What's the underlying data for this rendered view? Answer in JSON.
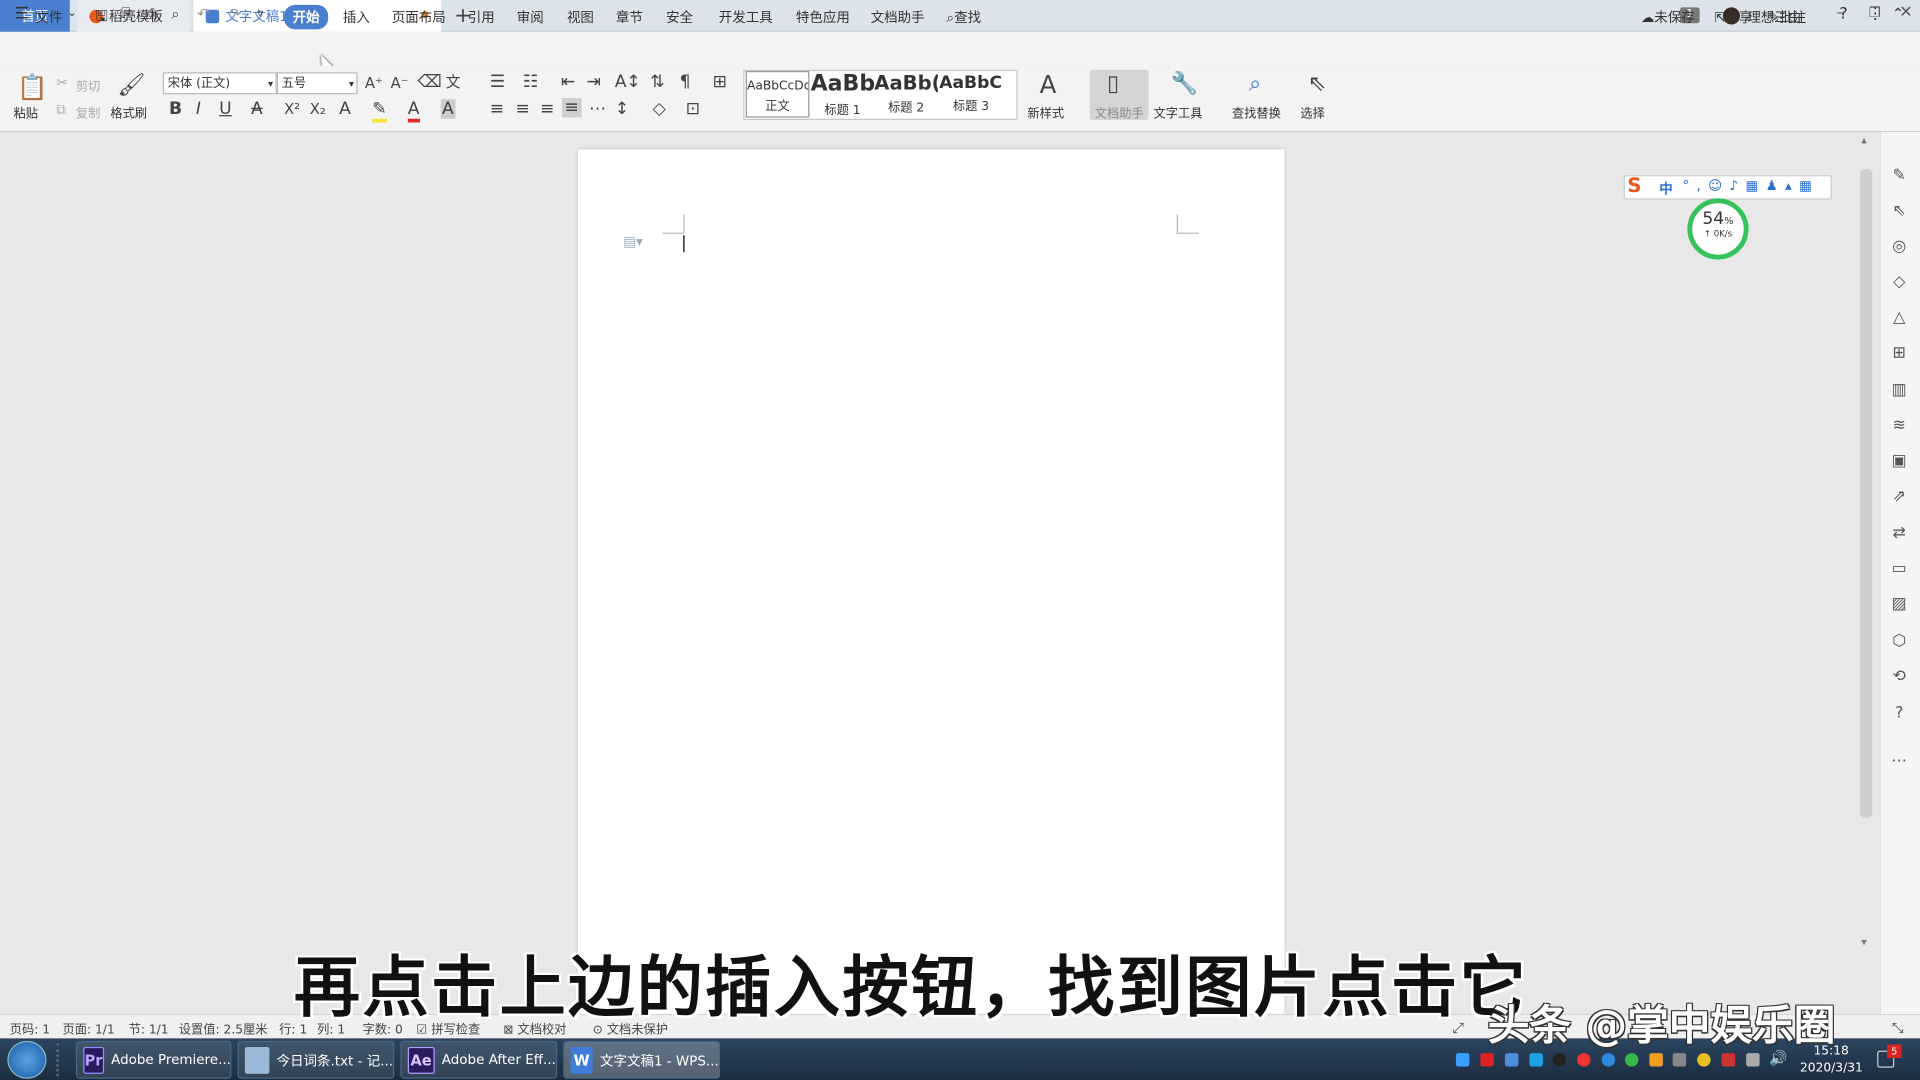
{
  "tabs": {
    "home": "首页",
    "daoke": "稻壳模板",
    "doc": "文字文稿1",
    "win_badge": "1",
    "user": "理想三由"
  },
  "menubar": {
    "file": "文件",
    "items": [
      "开始",
      "插入",
      "页面布局",
      "引用",
      "审阅",
      "视图",
      "章节",
      "安全",
      "开发工具",
      "特色应用",
      "文档助手"
    ],
    "search": "查找",
    "unsaved": "未保存",
    "share": "分享",
    "comment": "批注"
  },
  "ribbon": {
    "paste": "粘贴",
    "cut": "剪切",
    "copy": "复制",
    "format_painter": "格式刷",
    "font_name": "宋体 (正文)",
    "font_size": "五号",
    "styles": [
      {
        "sample": "AaBbCcDd",
        "label": "正文"
      },
      {
        "sample": "AaBb",
        "label": "标题 1"
      },
      {
        "sample": "AaBb(",
        "label": "标题 2"
      },
      {
        "sample": "AaBbC(",
        "label": "标题 3"
      }
    ],
    "new_style": "新样式",
    "doc_assistant": "文档助手",
    "text_tools": "文字工具",
    "find_replace": "查找替换",
    "select": "选择"
  },
  "overlay": {
    "gauge_percent": "54",
    "gauge_unit": "%",
    "gauge_speed": "0K/s",
    "ime_lang": "中",
    "subtitle": "再点击上边的插入按钮，找到图片点击它",
    "watermark": "头条 @掌中娱乐圈"
  },
  "status": {
    "page_no": "页码: 1",
    "pages": "页面: 1/1",
    "section": "节: 1/1",
    "setting": "设置值: 2.5厘米",
    "row": "行: 1",
    "col": "列: 1",
    "words": "字数: 0",
    "spell": "拼写检查",
    "proof": "文档校对",
    "protect": "文档未保护"
  },
  "taskbar": {
    "items": [
      {
        "icon": "Pr",
        "label": "Adobe Premiere...",
        "color": "#2a1a5e"
      },
      {
        "icon": "",
        "label": "今日词条.txt - 记...",
        "color": "#5b7aa0"
      },
      {
        "icon": "Ae",
        "label": "Adobe After Eff...",
        "color": "#2a1a5e"
      },
      {
        "icon": "W",
        "label": "文字文稿1 - WPS...",
        "color": "#3d7cd9"
      }
    ],
    "time": "15:18",
    "date": "2020/3/31",
    "badge": "5"
  }
}
